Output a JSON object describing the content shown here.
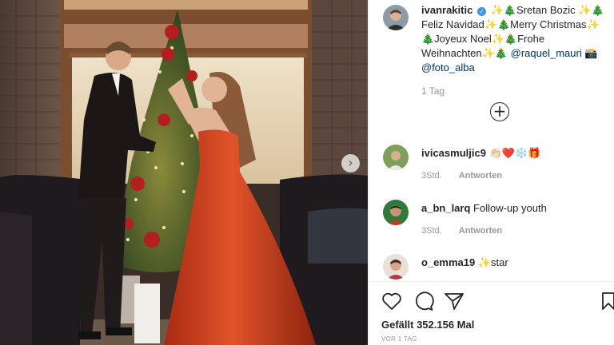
{
  "post": {
    "author": "ivanrakitic",
    "caption_text": "✨🎄Sretan Bozic ✨🎄 Feliz Navidad✨🎄Merry Christmas✨ 🎄Joyeux Noel✨🎄Frohe Weihnachten✨🎄",
    "mention_1": "@raquel_mauri",
    "mention_1_suffix": " 📸",
    "mention_2": "@foto_alba",
    "time_ago": "1 Tag",
    "likes_text": "Gefällt 352.156 Mal",
    "date": "VOR 1 TAG"
  },
  "comments": [
    {
      "user": "ivicasmuljic9",
      "text": "👏🏻❤️❄️🎁",
      "meta_time": "3Std.",
      "reply_label": "Antworten"
    },
    {
      "user": "a_bn_larq",
      "text": "Follow-up youth",
      "meta_time": "3Std.",
      "reply_label": "Antworten"
    },
    {
      "user": "o_emma19",
      "text": "✨star",
      "meta_time": "",
      "reply_label": ""
    }
  ],
  "icons": {
    "like": "heart-icon",
    "comment": "comment-icon",
    "share": "share-icon",
    "save": "bookmark-icon",
    "next": "chevron-right-icon",
    "more": "plus-circle-icon"
  },
  "colors": {
    "dress": "#d2421f",
    "tree": "#3f5a2a",
    "link": "#003569",
    "verified": "#3897f0"
  }
}
